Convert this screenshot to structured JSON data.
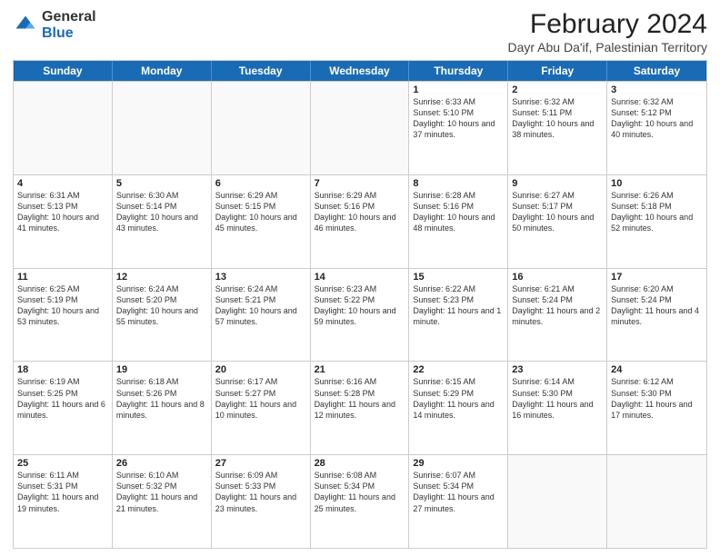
{
  "logo": {
    "general": "General",
    "blue": "Blue"
  },
  "header": {
    "title": "February 2024",
    "subtitle": "Dayr Abu Da'if, Palestinian Territory"
  },
  "days": [
    "Sunday",
    "Monday",
    "Tuesday",
    "Wednesday",
    "Thursday",
    "Friday",
    "Saturday"
  ],
  "rows": [
    [
      {
        "day": "",
        "text": ""
      },
      {
        "day": "",
        "text": ""
      },
      {
        "day": "",
        "text": ""
      },
      {
        "day": "",
        "text": ""
      },
      {
        "day": "1",
        "text": "Sunrise: 6:33 AM\nSunset: 5:10 PM\nDaylight: 10 hours and 37 minutes."
      },
      {
        "day": "2",
        "text": "Sunrise: 6:32 AM\nSunset: 5:11 PM\nDaylight: 10 hours and 38 minutes."
      },
      {
        "day": "3",
        "text": "Sunrise: 6:32 AM\nSunset: 5:12 PM\nDaylight: 10 hours and 40 minutes."
      }
    ],
    [
      {
        "day": "4",
        "text": "Sunrise: 6:31 AM\nSunset: 5:13 PM\nDaylight: 10 hours and 41 minutes."
      },
      {
        "day": "5",
        "text": "Sunrise: 6:30 AM\nSunset: 5:14 PM\nDaylight: 10 hours and 43 minutes."
      },
      {
        "day": "6",
        "text": "Sunrise: 6:29 AM\nSunset: 5:15 PM\nDaylight: 10 hours and 45 minutes."
      },
      {
        "day": "7",
        "text": "Sunrise: 6:29 AM\nSunset: 5:16 PM\nDaylight: 10 hours and 46 minutes."
      },
      {
        "day": "8",
        "text": "Sunrise: 6:28 AM\nSunset: 5:16 PM\nDaylight: 10 hours and 48 minutes."
      },
      {
        "day": "9",
        "text": "Sunrise: 6:27 AM\nSunset: 5:17 PM\nDaylight: 10 hours and 50 minutes."
      },
      {
        "day": "10",
        "text": "Sunrise: 6:26 AM\nSunset: 5:18 PM\nDaylight: 10 hours and 52 minutes."
      }
    ],
    [
      {
        "day": "11",
        "text": "Sunrise: 6:25 AM\nSunset: 5:19 PM\nDaylight: 10 hours and 53 minutes."
      },
      {
        "day": "12",
        "text": "Sunrise: 6:24 AM\nSunset: 5:20 PM\nDaylight: 10 hours and 55 minutes."
      },
      {
        "day": "13",
        "text": "Sunrise: 6:24 AM\nSunset: 5:21 PM\nDaylight: 10 hours and 57 minutes."
      },
      {
        "day": "14",
        "text": "Sunrise: 6:23 AM\nSunset: 5:22 PM\nDaylight: 10 hours and 59 minutes."
      },
      {
        "day": "15",
        "text": "Sunrise: 6:22 AM\nSunset: 5:23 PM\nDaylight: 11 hours and 1 minute."
      },
      {
        "day": "16",
        "text": "Sunrise: 6:21 AM\nSunset: 5:24 PM\nDaylight: 11 hours and 2 minutes."
      },
      {
        "day": "17",
        "text": "Sunrise: 6:20 AM\nSunset: 5:24 PM\nDaylight: 11 hours and 4 minutes."
      }
    ],
    [
      {
        "day": "18",
        "text": "Sunrise: 6:19 AM\nSunset: 5:25 PM\nDaylight: 11 hours and 6 minutes."
      },
      {
        "day": "19",
        "text": "Sunrise: 6:18 AM\nSunset: 5:26 PM\nDaylight: 11 hours and 8 minutes."
      },
      {
        "day": "20",
        "text": "Sunrise: 6:17 AM\nSunset: 5:27 PM\nDaylight: 11 hours and 10 minutes."
      },
      {
        "day": "21",
        "text": "Sunrise: 6:16 AM\nSunset: 5:28 PM\nDaylight: 11 hours and 12 minutes."
      },
      {
        "day": "22",
        "text": "Sunrise: 6:15 AM\nSunset: 5:29 PM\nDaylight: 11 hours and 14 minutes."
      },
      {
        "day": "23",
        "text": "Sunrise: 6:14 AM\nSunset: 5:30 PM\nDaylight: 11 hours and 16 minutes."
      },
      {
        "day": "24",
        "text": "Sunrise: 6:12 AM\nSunset: 5:30 PM\nDaylight: 11 hours and 17 minutes."
      }
    ],
    [
      {
        "day": "25",
        "text": "Sunrise: 6:11 AM\nSunset: 5:31 PM\nDaylight: 11 hours and 19 minutes."
      },
      {
        "day": "26",
        "text": "Sunrise: 6:10 AM\nSunset: 5:32 PM\nDaylight: 11 hours and 21 minutes."
      },
      {
        "day": "27",
        "text": "Sunrise: 6:09 AM\nSunset: 5:33 PM\nDaylight: 11 hours and 23 minutes."
      },
      {
        "day": "28",
        "text": "Sunrise: 6:08 AM\nSunset: 5:34 PM\nDaylight: 11 hours and 25 minutes."
      },
      {
        "day": "29",
        "text": "Sunrise: 6:07 AM\nSunset: 5:34 PM\nDaylight: 11 hours and 27 minutes."
      },
      {
        "day": "",
        "text": ""
      },
      {
        "day": "",
        "text": ""
      }
    ]
  ]
}
